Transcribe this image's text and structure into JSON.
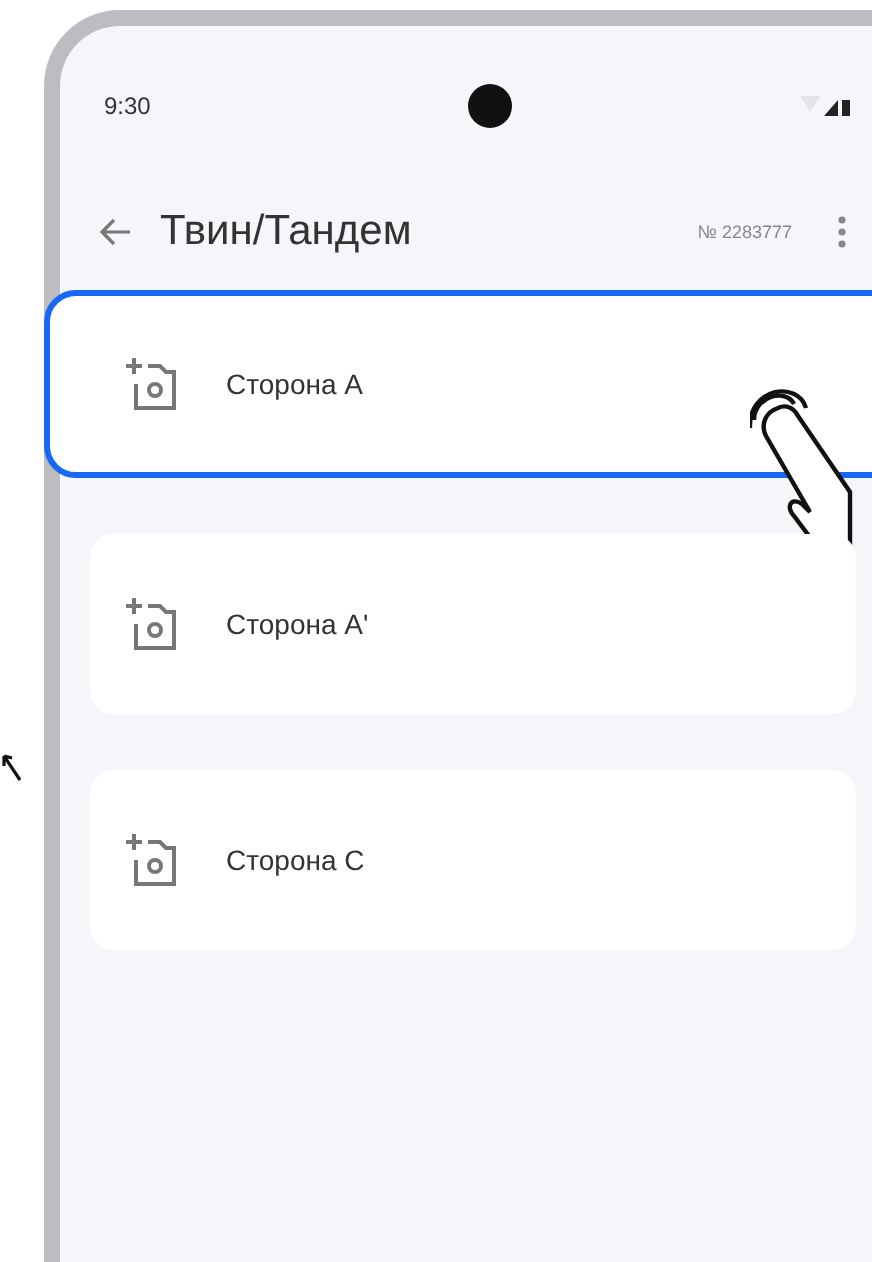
{
  "status_bar": {
    "time": "9:30"
  },
  "header": {
    "title": "Твин/Тандем",
    "number": "№ 2283777"
  },
  "items": [
    {
      "label": "Сторона A",
      "selected": true
    },
    {
      "label": "Сторона A'",
      "selected": false
    },
    {
      "label": "Сторона C",
      "selected": false
    }
  ]
}
